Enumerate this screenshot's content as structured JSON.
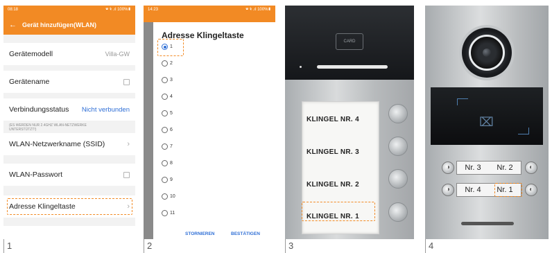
{
  "panel1": {
    "status_time": "08:18",
    "status_right": "🕿 ⚘ .ıl 100%▮",
    "header_title": "Gerät hinzufügen(WLAN)",
    "accent": "#f28a24",
    "rows": [
      {
        "label": "Gerätemodell",
        "value": "Villa-GW"
      },
      {
        "label": "Gerätename"
      },
      {
        "label": "Verbindungsstatus",
        "value": "Nicht verbunden"
      },
      {
        "label": "WLAN-Netzwerkname (SSID)"
      },
      {
        "label": "WLAN-Passwort"
      },
      {
        "label": "Adresse Klingeltaste"
      }
    ],
    "note": "(ES WERDEN NUR 2.4GHZ WLAN-NETZWERKE UNTERSTÜTZT!)"
  },
  "panel2": {
    "status_time": "14:23",
    "status_right": "🕿 ⚘ .ıl 100%▮",
    "dialog_title": "Adresse Klingeltaste",
    "options": [
      "1",
      "2",
      "3",
      "4",
      "5",
      "6",
      "7",
      "8",
      "9",
      "10",
      "11"
    ],
    "selected": "1",
    "cancel_label": "STORNIEREN",
    "confirm_label": "BESTÄTIGEN"
  },
  "panel3": {
    "card_label": "CARD",
    "labels": [
      "KLINGEL NR. 4",
      "KLINGEL NR. 3",
      "KLINGEL NR. 2",
      "KLINGEL NR. 1"
    ]
  },
  "panel4": {
    "plate_top": [
      "Nr. 3",
      "Nr. 2"
    ],
    "plate_bottom": [
      "Nr. 4",
      "Nr. 1"
    ]
  },
  "captions": [
    "1",
    "2",
    "3",
    "4"
  ]
}
